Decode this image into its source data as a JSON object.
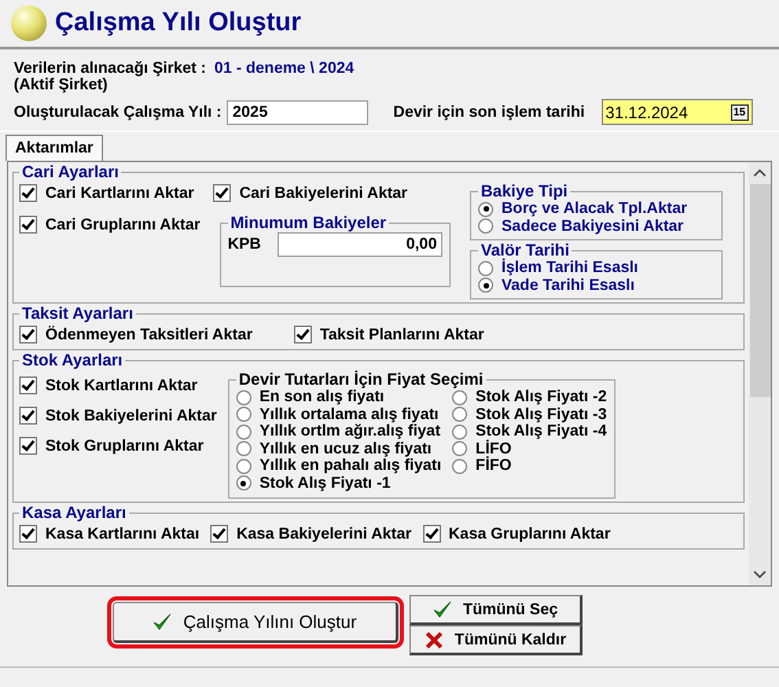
{
  "window": {
    "title": "Çalışma Yılı Oluştur"
  },
  "source": {
    "label": "Verilerin alınacağı Şirket :",
    "sublabel": "(Aktif Şirket)",
    "value": "01 - deneme \\ 2024"
  },
  "year": {
    "label": "Oluşturulacak Çalışma Yılı :",
    "value": "2025"
  },
  "last_date": {
    "label": "Devir için son işlem tarihi",
    "value": "31.12.2024",
    "calendar_icon": "15"
  },
  "tabs": [
    {
      "label": "Aktarımlar",
      "selected": true
    }
  ],
  "cari": {
    "title": "Cari Ayarları",
    "checks": [
      {
        "label": "Cari Kartlarını Aktar",
        "checked": true
      },
      {
        "label": "Cari Bakiyelerini Aktar",
        "checked": true
      },
      {
        "label": "Cari Gruplarını Aktar",
        "checked": true
      }
    ],
    "min_balance": {
      "title": "Minumum Bakiyeler",
      "label": "KPB",
      "value": "0,00"
    },
    "balance_type": {
      "title": "Bakiye Tipi",
      "options": [
        {
          "label": "Borç ve Alacak Tpl.Aktar",
          "selected": true
        },
        {
          "label": "Sadece Bakiyesini Aktar",
          "selected": false
        }
      ]
    },
    "value_date": {
      "title": "Valör Tarihi",
      "options": [
        {
          "label": "İşlem Tarihi Esaslı",
          "selected": false
        },
        {
          "label": "Vade Tarihi Esaslı",
          "selected": true
        }
      ]
    }
  },
  "taksit": {
    "title": "Taksit Ayarları",
    "checks": [
      {
        "label": "Ödenmeyen Taksitleri Aktar",
        "checked": true
      },
      {
        "label": "Taksit Planlarını Aktar",
        "checked": true
      }
    ]
  },
  "stok": {
    "title": "Stok Ayarları",
    "checks": [
      {
        "label": "Stok Kartlarını Aktar",
        "checked": true
      },
      {
        "label": "Stok Bakiyelerini Aktar",
        "checked": true
      },
      {
        "label": "Stok Gruplarını Aktar",
        "checked": true
      }
    ],
    "price": {
      "title": "Devir Tutarları İçin Fiyat Seçimi",
      "options": [
        {
          "label": "En son alış fiyatı",
          "selected": false
        },
        {
          "label": "Yıllık ortalama alış fiyatı",
          "selected": false
        },
        {
          "label": "Yıllık ortlm ağır.alış fiyat",
          "selected": false
        },
        {
          "label": "Yıllık en ucuz alış fiyatı",
          "selected": false
        },
        {
          "label": "Yıllık en pahalı alış fiyatı",
          "selected": false
        },
        {
          "label": "Stok Alış Fiyatı -1",
          "selected": true
        },
        {
          "label": "Stok Alış Fiyatı -2",
          "selected": false
        },
        {
          "label": "Stok Alış Fiyatı -3",
          "selected": false
        },
        {
          "label": "Stok Alış Fiyatı -4",
          "selected": false
        },
        {
          "label": "LİFO",
          "selected": false
        },
        {
          "label": "FİFO",
          "selected": false
        }
      ]
    }
  },
  "kasa": {
    "title": "Kasa Ayarları",
    "checks": [
      {
        "label": "Kasa Kartlarını Aktaı",
        "checked": true
      },
      {
        "label": "Kasa Bakiyelerini Aktar",
        "checked": true
      },
      {
        "label": "Kasa Gruplarını Aktar",
        "checked": true
      }
    ]
  },
  "buttons": [
    {
      "label": "Çalışma Yılını Oluştur",
      "kind": "create",
      "highlighted": true
    },
    {
      "label": "Tümünü Seç",
      "kind": "select"
    },
    {
      "label": "Tümünü Kaldır",
      "kind": "clear"
    }
  ]
}
